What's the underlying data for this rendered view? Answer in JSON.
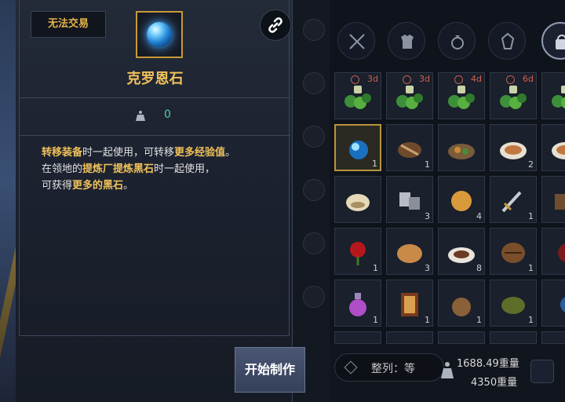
{
  "tooltip": {
    "trade_badge": "无法交易",
    "item_name": "克罗恩石",
    "weight_value": "0",
    "desc_line1": [
      {
        "t": "转移装备",
        "hl": true
      },
      {
        "t": "时一起使用，可转移",
        "hl": false
      },
      {
        "t": "更多经验值",
        "hl": true
      },
      {
        "t": "。",
        "hl": false
      }
    ],
    "desc_line2": [
      {
        "t": "在领地的",
        "hl": false
      },
      {
        "t": "提炼厂",
        "hl": true
      },
      {
        "t": "提炼黑石",
        "hl": true
      },
      {
        "t": "时一起使用，",
        "hl": false
      }
    ],
    "desc_line3": [
      {
        "t": "可获得",
        "hl": false
      },
      {
        "t": "更多的黑石",
        "hl": true
      },
      {
        "t": "。",
        "hl": false
      }
    ],
    "make_button": "开始制作"
  },
  "inventory": {
    "tabs": [
      "swords-icon",
      "armor-icon",
      "ring-icon",
      "crystal-icon",
      "bag-icon"
    ],
    "rows": [
      [
        {
          "item": "herb-bundle",
          "time": "3d"
        },
        {
          "item": "herb-bundle",
          "time": "3d"
        },
        {
          "item": "herb-bundle",
          "time": "4d"
        },
        {
          "item": "herb-bundle",
          "time": "6d"
        },
        {
          "item": "herb-bundle",
          "time": ""
        }
      ],
      [
        {
          "item": "caphras-stone",
          "count": "1"
        },
        {
          "item": "roast-meat",
          "count": "1"
        },
        {
          "item": "meat-dish",
          "count": ""
        },
        {
          "item": "food-plate",
          "count": "2"
        },
        {
          "item": "food-plate",
          "count": ""
        }
      ],
      [
        {
          "item": "dumpling",
          "count": ""
        },
        {
          "item": "metal-ingot",
          "count": "3"
        },
        {
          "item": "cracker",
          "count": "4"
        },
        {
          "item": "dagger",
          "count": "1"
        },
        {
          "item": "chest",
          "count": ""
        }
      ],
      [
        {
          "item": "rose",
          "count": "1"
        },
        {
          "item": "bread",
          "count": "3"
        },
        {
          "item": "steak-plate",
          "count": "8"
        },
        {
          "item": "barrel",
          "count": "1"
        },
        {
          "item": "red-item",
          "count": ""
        }
      ],
      [
        {
          "item": "potion",
          "count": "1"
        },
        {
          "item": "picture-frame",
          "count": "1"
        },
        {
          "item": "pouch",
          "count": "1"
        },
        {
          "item": "moss-stone",
          "count": "1"
        },
        {
          "item": "blue-item",
          "count": ""
        }
      ]
    ],
    "sort_label": "整列：等",
    "weight_current": "1688.49重量",
    "weight_max": "4350重量"
  },
  "colors": {
    "gold": "#f0c25a",
    "teal": "#4ecfa6",
    "frame": "#c89a3a"
  }
}
